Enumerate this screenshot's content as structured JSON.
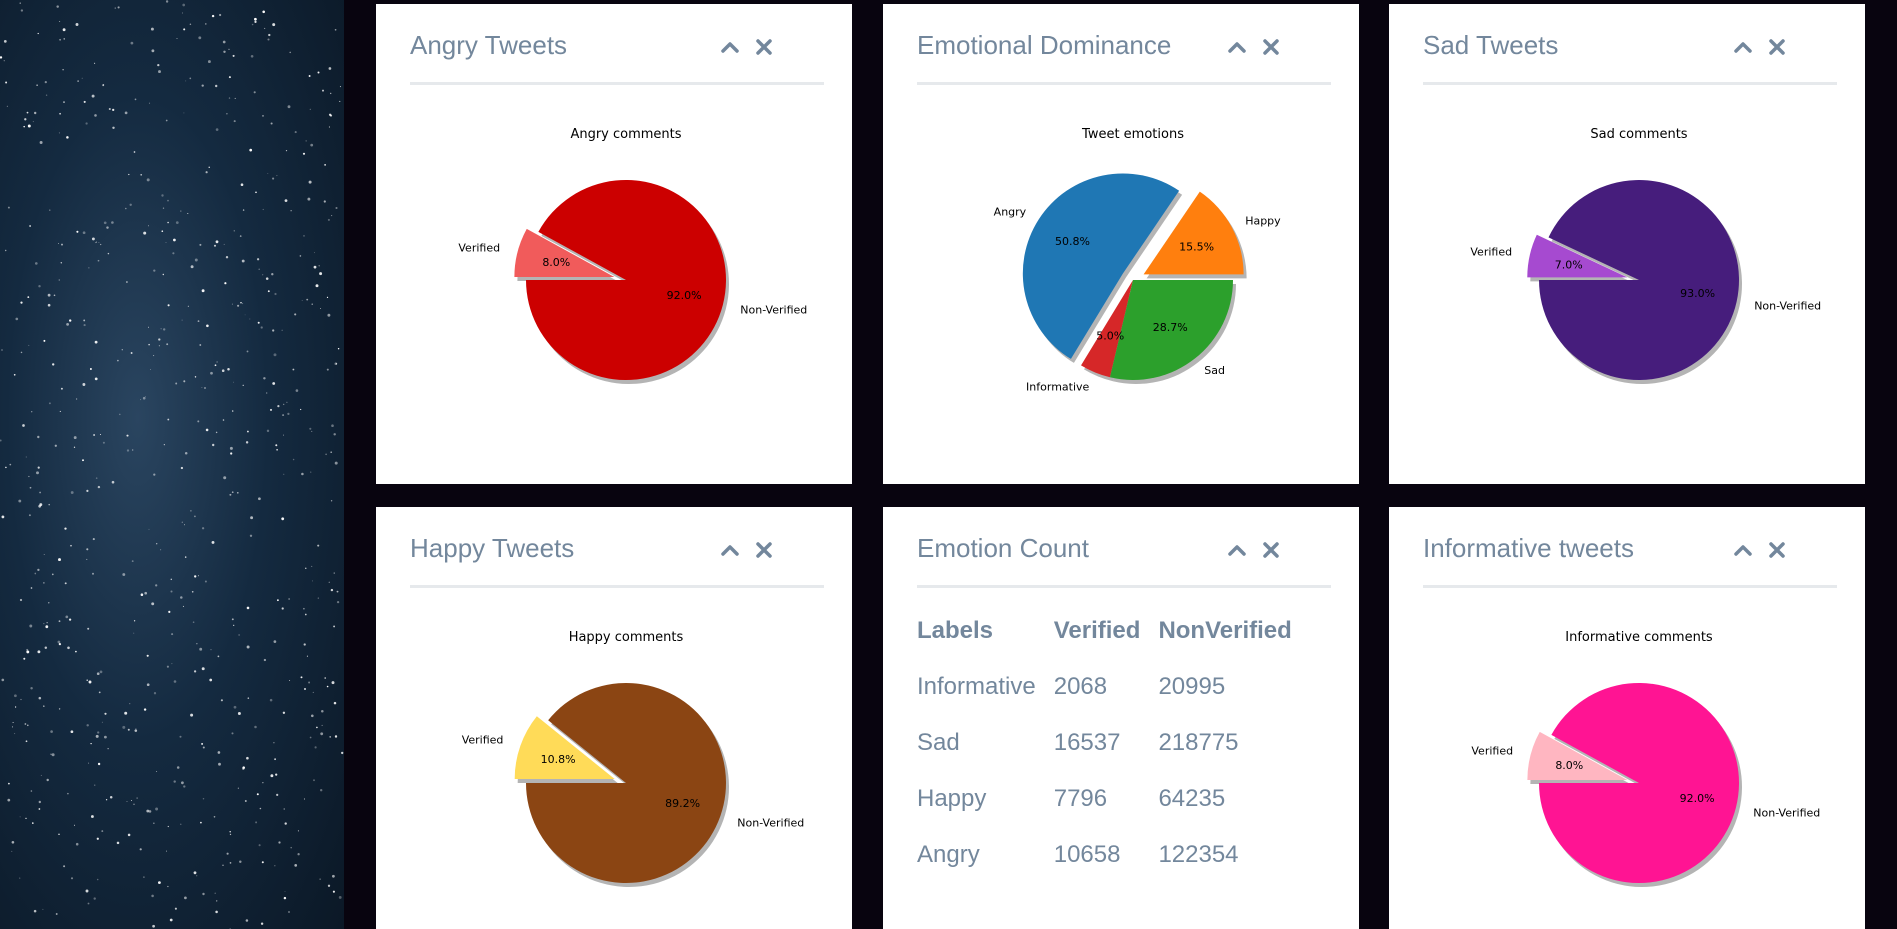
{
  "panels": {
    "angry": {
      "title": "Angry Tweets",
      "chart_data": {
        "type": "pie",
        "title": "Angry comments",
        "slices": [
          {
            "label": "Non-Verified",
            "value": 92.0,
            "pct": "92.0%",
            "color": "#cc0000"
          },
          {
            "label": "Verified",
            "value": 8.0,
            "pct": "8.0%",
            "color": "#f15b5b",
            "explode": true
          }
        ]
      }
    },
    "dominance": {
      "title": "Emotional Dominance",
      "chart_data": {
        "type": "pie",
        "title": "Tweet emotions",
        "slices": [
          {
            "label": "Happy",
            "value": 15.5,
            "pct": "15.5%",
            "color": "#ff7f0e",
            "explode": true
          },
          {
            "label": "Angry",
            "value": 50.8,
            "pct": "50.8%",
            "color": "#1f77b4",
            "explode": true
          },
          {
            "label": "Informative",
            "value": 5.0,
            "pct": "5.0%",
            "color": "#d62728"
          },
          {
            "label": "Sad",
            "value": 28.7,
            "pct": "28.7%",
            "color": "#2ca02c"
          }
        ]
      }
    },
    "sad": {
      "title": "Sad Tweets",
      "chart_data": {
        "type": "pie",
        "title": "Sad comments",
        "slices": [
          {
            "label": "Non-Verified",
            "value": 93.0,
            "pct": "93.0%",
            "color": "#461d7c"
          },
          {
            "label": "Verified",
            "value": 7.0,
            "pct": "7.0%",
            "color": "#a64ad0",
            "explode": true
          }
        ]
      }
    },
    "happy": {
      "title": "Happy Tweets",
      "chart_data": {
        "type": "pie",
        "title": "Happy comments",
        "slices": [
          {
            "label": "Non-Verified",
            "value": 89.2,
            "pct": "89.2%",
            "color": "#8b4513"
          },
          {
            "label": "Verified",
            "value": 10.8,
            "pct": "10.8%",
            "color": "#ffdb58",
            "explode": true
          }
        ]
      }
    },
    "count": {
      "title": "Emotion Count",
      "table": {
        "headers": [
          "Labels",
          "Verified",
          "NonVerified"
        ],
        "rows": [
          [
            "Informative",
            "2068",
            "20995"
          ],
          [
            "Sad",
            "16537",
            "218775"
          ],
          [
            "Happy",
            "7796",
            "64235"
          ],
          [
            "Angry",
            "10658",
            "122354"
          ]
        ]
      }
    },
    "informative": {
      "title": "Informative tweets",
      "chart_data": {
        "type": "pie",
        "title": "Informative comments",
        "slices": [
          {
            "label": "Non-Verified",
            "value": 92.0,
            "pct": "92.0%",
            "color": "#ff1493"
          },
          {
            "label": "Verified",
            "value": 8.0,
            "pct": "8.0%",
            "color": "#ffb6c1",
            "explode": true
          }
        ]
      }
    }
  },
  "colors": {
    "title_text": "#73879c",
    "panel_bg": "#ffffff",
    "page_bg": "#08040f"
  },
  "icons": {
    "collapse": "chevron-up-icon",
    "close": "close-icon"
  }
}
